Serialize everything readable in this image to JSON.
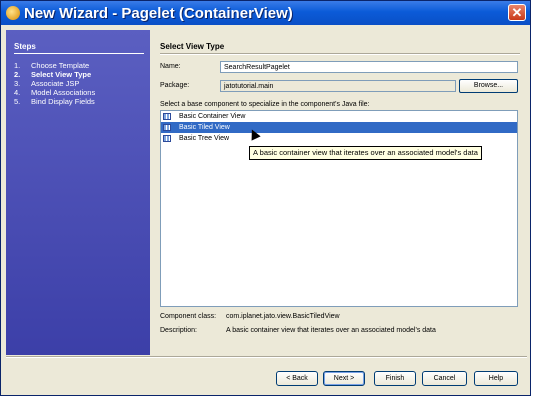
{
  "window": {
    "title": "New Wizard - Pagelet (ContainerView)",
    "close_glyph": "✕"
  },
  "steps": {
    "title": "Steps",
    "items": [
      {
        "num": "1.",
        "label": "Choose Template"
      },
      {
        "num": "2.",
        "label": "Select View Type"
      },
      {
        "num": "3.",
        "label": "Associate JSP"
      },
      {
        "num": "4.",
        "label": "Model Associations"
      },
      {
        "num": "5.",
        "label": "Bind Display Fields"
      }
    ]
  },
  "main": {
    "title": "Select View Type",
    "name_label": "Name:",
    "name_value": "SearchResultPagelet",
    "package_label": "Package:",
    "package_value": "jatotutorial.main",
    "browse_label": "Browse...",
    "instruction": "Select a base component to specialize in the component's Java file:",
    "components": [
      {
        "label": "Basic Container View"
      },
      {
        "label": "Basic Tiled View"
      },
      {
        "label": "Basic Tree View"
      }
    ],
    "tooltip": "A basic container view that iterates over an associated model's data",
    "component_class_label": "Component class:",
    "component_class_value": "com.iplanet.jato.view.BasicTiledView",
    "description_label": "Description:",
    "description_value": "A basic container view that iterates over an associated model's data"
  },
  "buttons": {
    "back": "< Back",
    "next": "Next >",
    "finish": "Finish",
    "cancel": "Cancel",
    "help": "Help"
  }
}
